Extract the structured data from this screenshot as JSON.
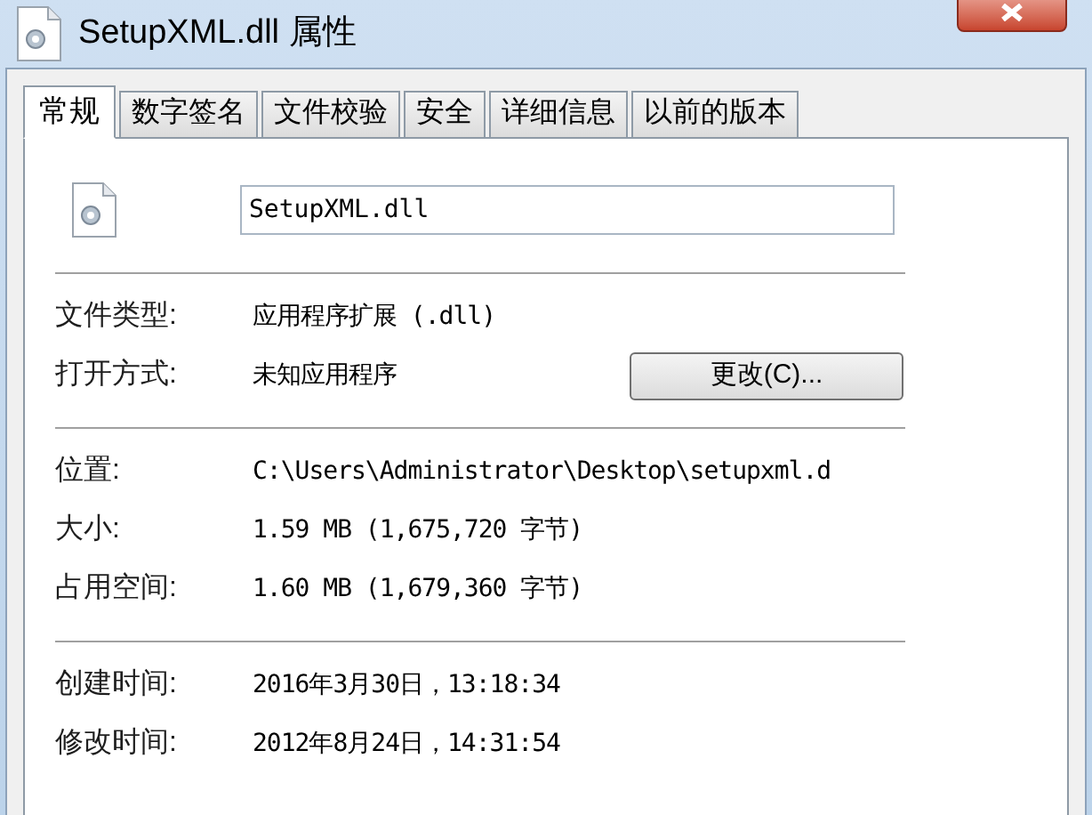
{
  "window": {
    "title": "SetupXML.dll 属性"
  },
  "tabs": [
    {
      "label": "常规",
      "selected": true
    },
    {
      "label": "数字签名",
      "selected": false
    },
    {
      "label": "文件校验",
      "selected": false
    },
    {
      "label": "安全",
      "selected": false
    },
    {
      "label": "详细信息",
      "selected": false
    },
    {
      "label": "以前的版本",
      "selected": false
    }
  ],
  "file_name": "SetupXML.dll",
  "sections": [
    {
      "rows": [
        {
          "label": "文件类型:",
          "value": "应用程序扩展 (.dll)"
        },
        {
          "label": "打开方式:",
          "value": "未知应用程序",
          "button": "更改(C)..."
        }
      ]
    },
    {
      "rows": [
        {
          "label": "位置:",
          "value": "C:\\Users\\Administrator\\Desktop\\setupxml.d"
        },
        {
          "label": "大小:",
          "value": "1.59 MB (1,675,720 字节)"
        },
        {
          "label": "占用空间:",
          "value": "1.60 MB (1,679,360 字节)"
        }
      ]
    },
    {
      "rows": [
        {
          "label": "创建时间:",
          "value": "2016年3月30日，13:18:34"
        },
        {
          "label": "修改时间:",
          "value": "2012年8月24日，14:31:54"
        }
      ]
    }
  ]
}
